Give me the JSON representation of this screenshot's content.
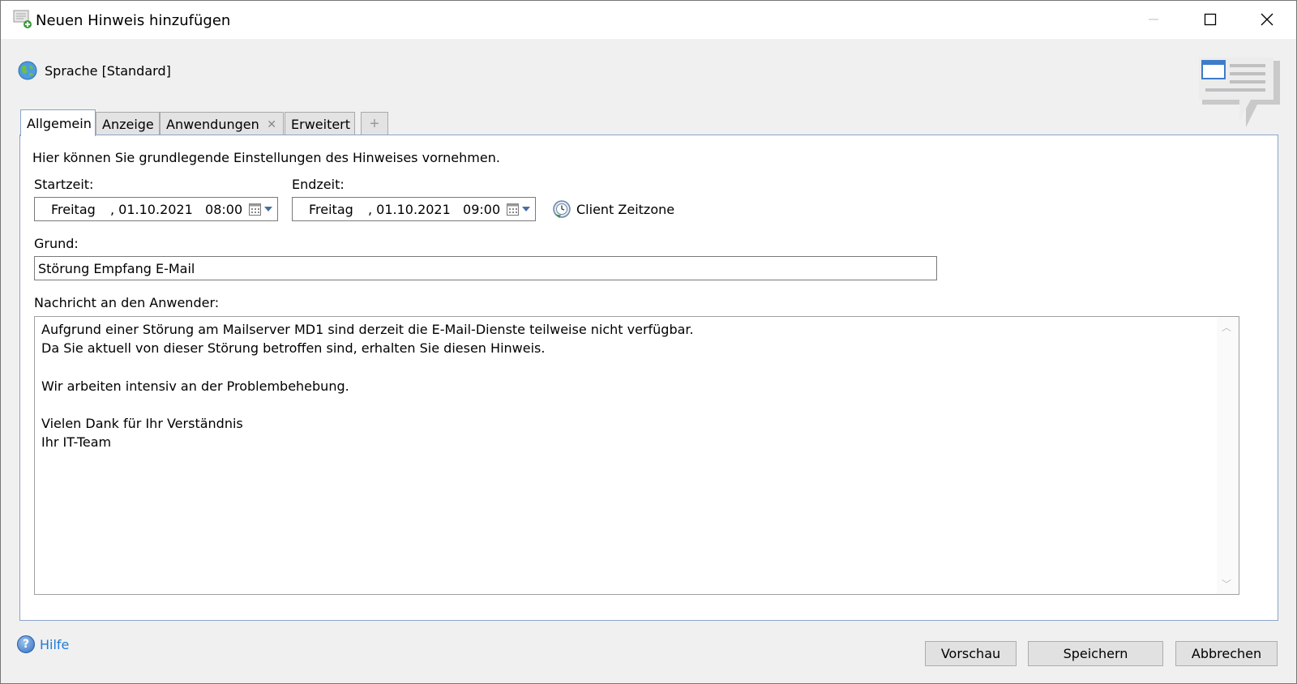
{
  "window": {
    "title": "Neuen Hinweis hinzufügen"
  },
  "language": {
    "label": "Sprache [Standard]"
  },
  "tabs": [
    {
      "label": "Allgemein",
      "active": true
    },
    {
      "label": "Anzeige",
      "active": false
    },
    {
      "label": "Anwendungen",
      "active": false,
      "closable": true
    },
    {
      "label": "Erweitert",
      "active": false
    }
  ],
  "general": {
    "description": "Hier können Sie grundlegende Einstellungen des Hinweises vornehmen.",
    "start_label": "Startzeit:",
    "start_day": "Freitag",
    "start_datetime": ", 01.10.2021   08:00",
    "end_label": "Endzeit:",
    "end_day": "Freitag",
    "end_datetime": ", 01.10.2021   09:00",
    "timezone_label": "Client Zeitzone",
    "reason_label": "Grund:",
    "reason_value": "Störung Empfang E-Mail",
    "message_label": "Nachricht an den Anwender:",
    "message_value": "Aufgrund einer Störung am Mailserver MD1 sind derzeit die E-Mail-Dienste teilweise nicht verfügbar.\nDa Sie aktuell von dieser Störung betroffen sind, erhalten Sie diesen Hinweis.\n\nWir arbeiten intensiv an der Problembehebung.\n\nVielen Dank für Ihr Verständnis\nIhr IT-Team"
  },
  "footer": {
    "help_label": "Hilfe",
    "preview_label": "Vorschau",
    "save_label": "Speichern",
    "cancel_label": "Abbrechen"
  }
}
